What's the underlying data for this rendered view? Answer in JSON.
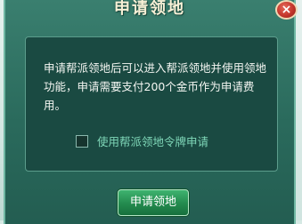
{
  "dialog": {
    "title": "申请领地",
    "close_label": "×",
    "description": "申请帮派领地后可以进入帮派领地并使用领地功能，申请需要支付200个金币作为申请费用。",
    "checkbox": {
      "label": "使用帮派领地令牌申请",
      "checked": false
    },
    "apply_button_label": "申请领地"
  },
  "colors": {
    "dialog_bg": "#2a6a5c",
    "panel_bg": "#1a4a42",
    "checkbox_label": "#7fd7b8",
    "button_green": "#238a4e",
    "close_red": "#c4362c"
  },
  "icons": {
    "close": "close-icon"
  }
}
